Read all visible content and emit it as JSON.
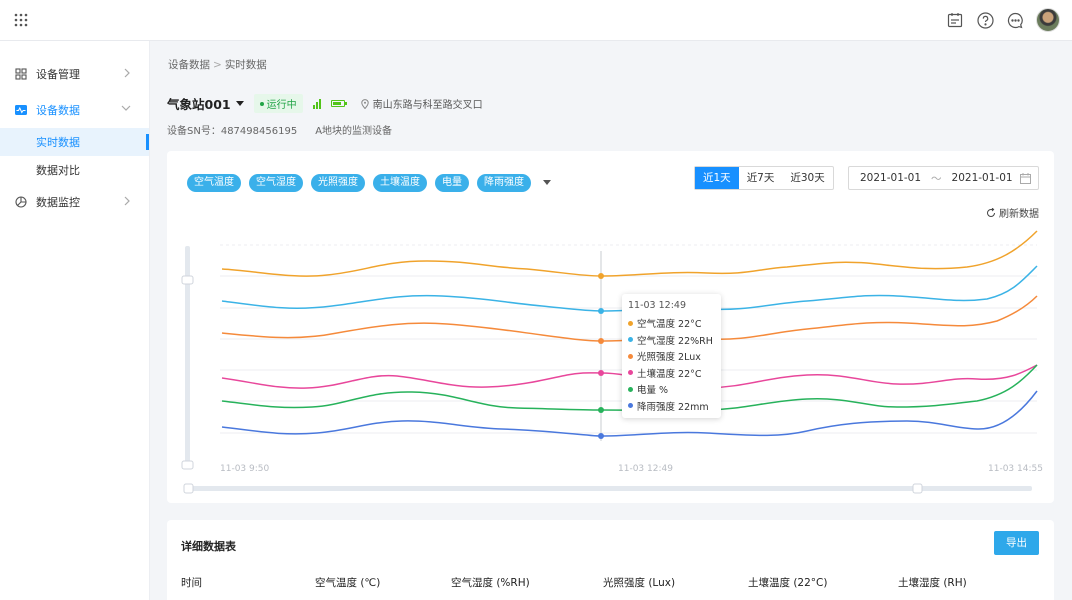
{
  "topbar": {
    "icons": [
      "apps-grid-icon",
      "calendar-note-icon",
      "help-icon",
      "message-icon",
      "user-avatar"
    ]
  },
  "sidebar": {
    "items": [
      {
        "label": "设备管理",
        "icon": "grid-icon"
      },
      {
        "label": "设备数据",
        "icon": "pulse-icon",
        "expanded": true,
        "children": [
          {
            "label": "实时数据",
            "active": true
          },
          {
            "label": "数据对比"
          }
        ]
      },
      {
        "label": "数据监控",
        "icon": "pie-chart-icon"
      }
    ]
  },
  "breadcrumb": {
    "root": "设备数据",
    "separator": ">",
    "current": "实时数据"
  },
  "station": {
    "name": "气象站001",
    "status": "运行中",
    "location": "南山东路与科至路交叉口",
    "sn_label": "设备SN号：487498456195",
    "description": "A地块的监测设备"
  },
  "filters": {
    "tags": [
      "空气温度",
      "空气湿度",
      "光照强度",
      "土壤温度",
      "电量",
      "降雨强度"
    ],
    "ranges": [
      "近1天",
      "近7天",
      "近30天"
    ],
    "active_range": "近1天",
    "date_start": "2021-01-01",
    "date_separator": "～",
    "date_end": "2021-01-01",
    "refresh_label": "刷新数据"
  },
  "chart_data": {
    "type": "line",
    "x_ticks": [
      "11-03 9:50",
      "11-03 12:49",
      "11-03 14:55"
    ],
    "series": [
      {
        "name": "空气温度",
        "color": "#f0a32c"
      },
      {
        "name": "空气湿度",
        "color": "#3bb3e6"
      },
      {
        "name": "光照强度",
        "color": "#f58a3b"
      },
      {
        "name": "土壤温度",
        "color": "#e8479b"
      },
      {
        "name": "电量",
        "color": "#27b25b"
      },
      {
        "name": "降雨强度",
        "color": "#4a78dd"
      }
    ],
    "grid": true,
    "legend": "none"
  },
  "tooltip": {
    "time": "11-03 12:49",
    "rows": [
      {
        "text": "空气温度 22°C",
        "color": "#f0a32c"
      },
      {
        "text": "空气湿度 22%RH",
        "color": "#3bb3e6"
      },
      {
        "text": "光照强度 2Lux",
        "color": "#f58a3b"
      },
      {
        "text": "土壤温度 22°C",
        "color": "#e8479b"
      },
      {
        "text": "电量 %",
        "color": "#27b25b"
      },
      {
        "text": "降雨强度 22mm",
        "color": "#4a78dd"
      }
    ]
  },
  "table": {
    "title": "详细数据表",
    "export_label": "导出",
    "columns": [
      "时间",
      "空气温度 (℃)",
      "空气湿度 (%RH)",
      "光照强度 (Lux)",
      "土壤温度 (22°C)",
      "土壤湿度 (RH)"
    ]
  }
}
